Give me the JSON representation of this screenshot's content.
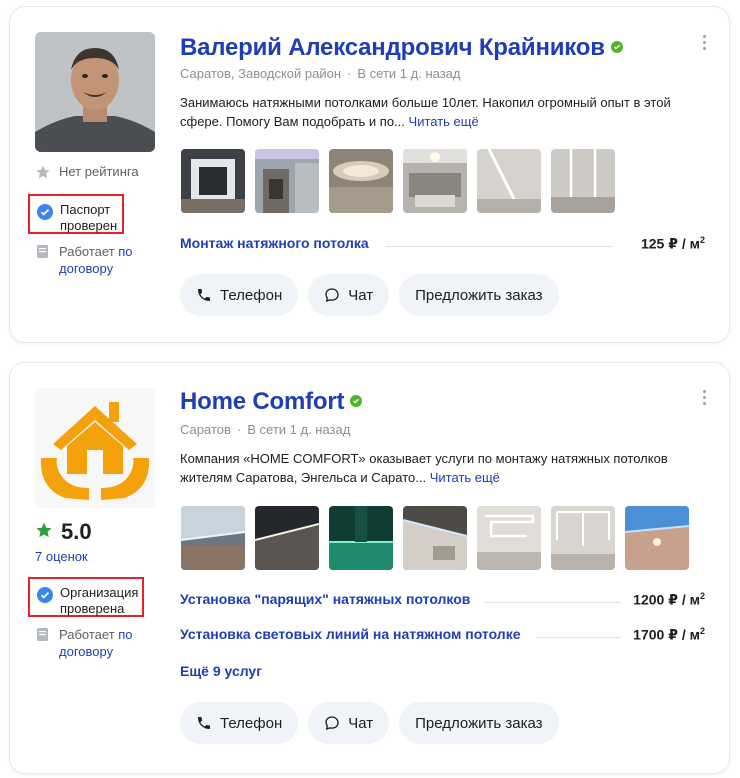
{
  "cards": [
    {
      "name": "Валерий Александрович Крайников",
      "location": "Саратов, Заводской район",
      "online": "В сети 1 д. назад",
      "description": "Занимаюсь натяжными потолками больше 10лет. Накопил огромный опыт в этой сфере. Помогу Вам подобрать и по...",
      "read_more": "Читать ещё",
      "rating": "Нет рейтинга",
      "check": "Паспорт проверен",
      "works_prefix": "Работает ",
      "works_link1": "по",
      "works_link2": "договору",
      "services": [
        {
          "name": "Монтаж натяжного потолка",
          "price": "125 ₽ / м",
          "unit_exp": "2"
        }
      ],
      "buttons": {
        "phone": "Телефон",
        "chat": "Чат",
        "order": "Предложить заказ"
      }
    },
    {
      "name": "Home Comfort",
      "location": "Саратов",
      "online": "В сети 1 д. назад",
      "description": "Компания «HOME COMFORT» оказывает услуги по монтажу натяжных потолков жителям Саратова, Энгельса и Сарато...",
      "read_more": "Читать ещё",
      "rating_value": "5.0",
      "reviews": "7 оценок",
      "check": "Организация проверена",
      "works_prefix": "Работает ",
      "works_link1": "по",
      "works_link2": "договору",
      "services": [
        {
          "name": "Установка \"парящих\" натяжных потолков",
          "price": "1200 ₽ / м",
          "unit_exp": "2"
        },
        {
          "name": "Установка световых линий на натяжном потолке",
          "price": "1700 ₽ / м",
          "unit_exp": "2"
        }
      ],
      "more_services": "Ещё 9 услуг",
      "buttons": {
        "phone": "Телефон",
        "chat": "Чат",
        "order": "Предложить заказ"
      }
    }
  ],
  "colors": {
    "link": "#1e3fb4",
    "verified": "#4fb52a",
    "check_badge": "#3a86f0",
    "highlight_border": "#e8202a",
    "star": "#2e9d3f",
    "house": "#f4a20b"
  }
}
